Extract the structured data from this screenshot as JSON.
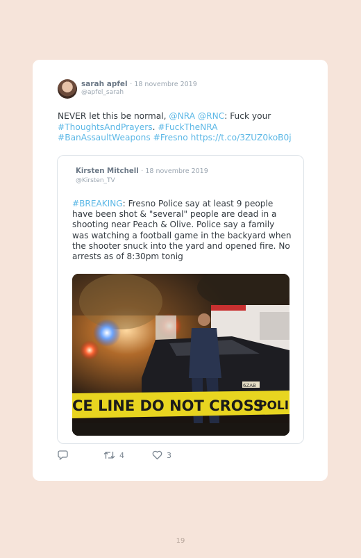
{
  "tweet": {
    "author_name": "sarah apfel",
    "date": "· 18 novembre 2019",
    "handle": "@apfel_sarah",
    "text_parts": {
      "p1": "NEVER let this be normal, ",
      "nra": "@NRA",
      "sp1": " ",
      "rnc": "@RNC",
      "p2": ": Fuck your",
      "thoughts": "#ThoughtsAndPrayers",
      "p3": ". ",
      "fucknra": "#FuckTheNRA",
      "ban": "#BanAssaultWeapons",
      "sp2": " ",
      "fresno": "#Fresno",
      "sp3": " ",
      "url": "https://t.co/3ZUZ0koB0j"
    }
  },
  "quoted": {
    "author_name": "Kirsten Mitchell",
    "date": "· 18 novembre 2019",
    "handle": "@Kirsten_TV",
    "hashtag": "#BREAKING",
    "text": ": Fresno Police say at least 9 people have been shot & \"several\" people are dead in a shooting near Peach & Olive. Police say a family was watching a football game in the backyard when the shooter snuck into the yard and opened fire. No arrests as of 8:30pm tonig",
    "photo_tape_text": "CE LINE DO NOT CROSS",
    "photo_tape_text_right": "POLICE",
    "photo_plate": "6ZAB"
  },
  "actions": {
    "reply_icon": "reply-icon",
    "retweet_icon": "retweet-icon",
    "retweet_count": "4",
    "like_icon": "heart-icon",
    "like_count": "3"
  },
  "page_number": "19",
  "colors": {
    "background": "#f6e4da",
    "link": "#5db8e6",
    "text": "#333a40",
    "muted": "#9aa5b0"
  }
}
